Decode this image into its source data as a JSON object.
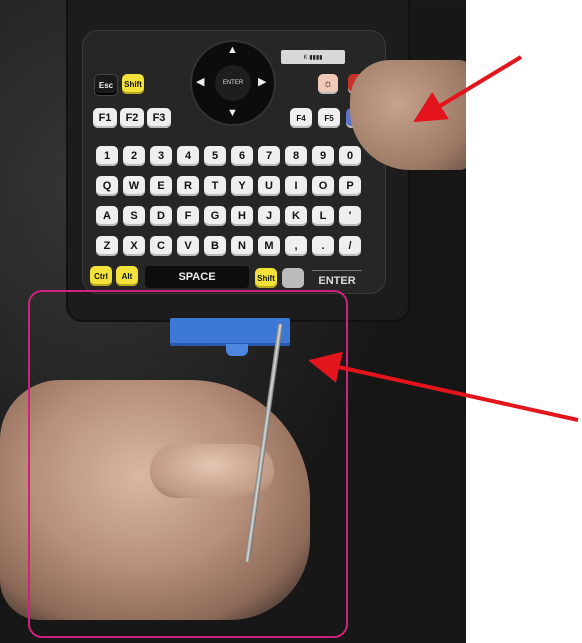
{
  "keyboard": {
    "row_special": [
      "Esc",
      "Shift",
      "F1",
      "F2",
      "F3"
    ],
    "dpad_center": "ENTER",
    "fkeys_right": [
      "F4",
      "F5"
    ],
    "num_row": [
      "1",
      "2",
      "3",
      "4",
      "5",
      "6",
      "7",
      "8",
      "9",
      "0"
    ],
    "row_q": [
      "Q",
      "W",
      "E",
      "R",
      "T",
      "Y",
      "U",
      "I",
      "O",
      "P"
    ],
    "row_a": [
      "A",
      "S",
      "D",
      "F",
      "G",
      "H",
      "J",
      "K",
      "L",
      "'"
    ],
    "row_z": [
      "Z",
      "X",
      "C",
      "V",
      "B",
      "N",
      "M",
      ",",
      ".",
      "/"
    ],
    "ctrl": "Ctrl",
    "alt": "Alt",
    "space": "SPACE",
    "shift": "Shift",
    "enter": "ENTER"
  },
  "annotation": {
    "arrow_color": "#e3141b",
    "highlight_color": "#d0227a"
  }
}
